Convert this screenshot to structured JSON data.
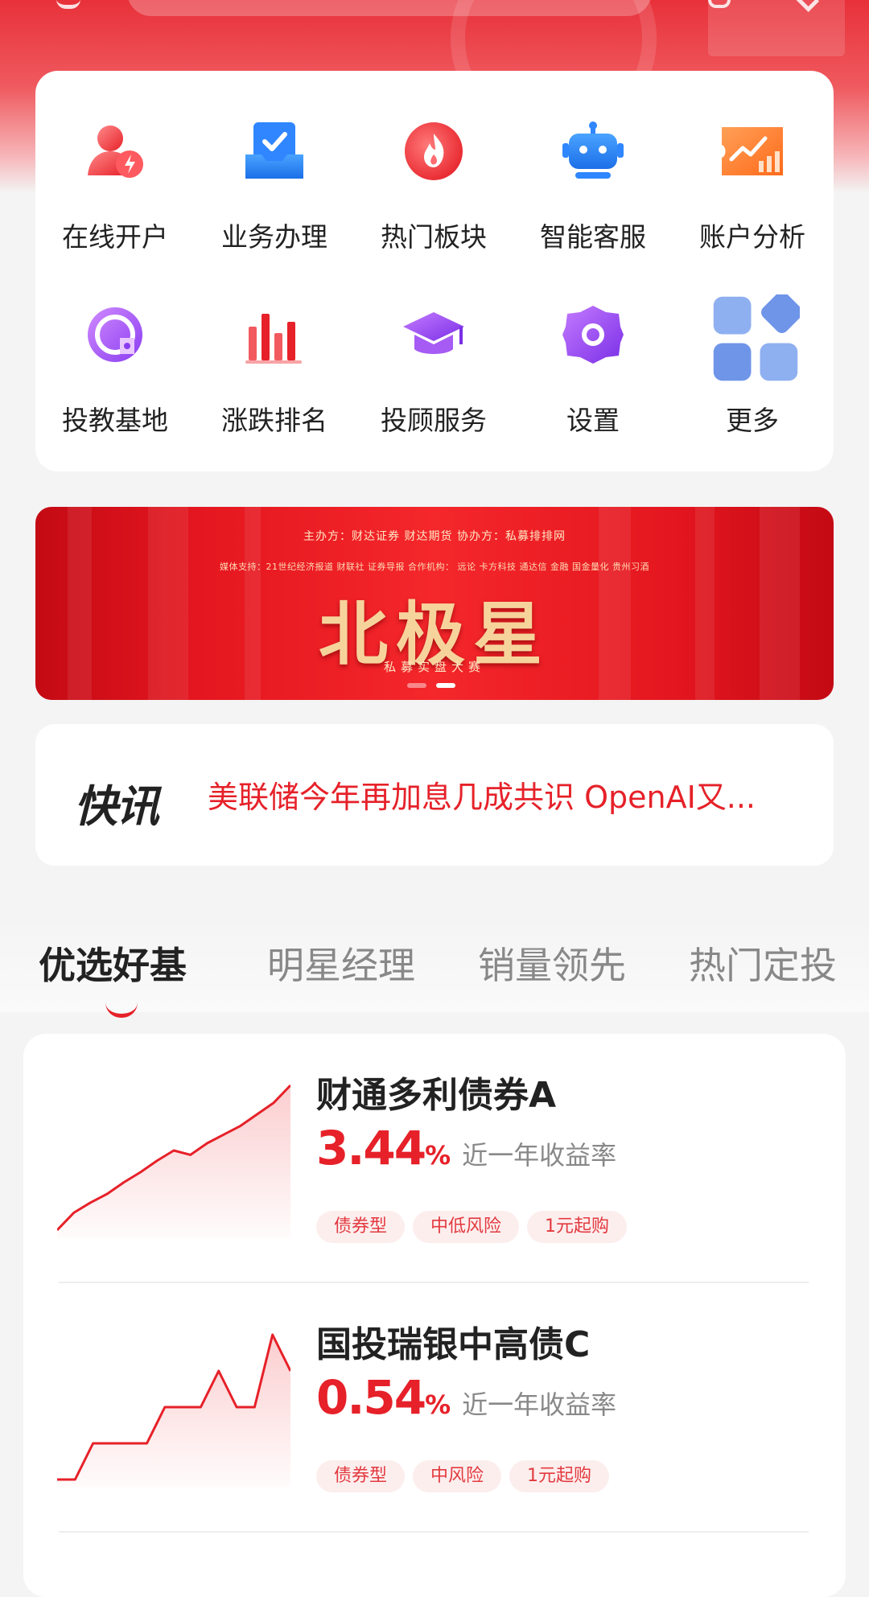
{
  "menu": {
    "items": [
      {
        "label": "在线开户",
        "icon": "user-flash-icon"
      },
      {
        "label": "业务办理",
        "icon": "checklist-tray-icon"
      },
      {
        "label": "热门板块",
        "icon": "flame-icon"
      },
      {
        "label": "智能客服",
        "icon": "robot-icon"
      },
      {
        "label": "账户分析",
        "icon": "trend-chart-icon"
      },
      {
        "label": "投教基地",
        "icon": "education-badge-icon"
      },
      {
        "label": "涨跌排名",
        "icon": "bar-ranking-icon"
      },
      {
        "label": "投顾服务",
        "icon": "graduation-cap-icon"
      },
      {
        "label": "设置",
        "icon": "settings-gear-icon"
      },
      {
        "label": "更多",
        "icon": "more-grid-icon"
      }
    ]
  },
  "banner": {
    "sponsor": "主办方：财达证券 财达期货   协办方：私募排排网",
    "media": "媒体支持：21世纪经济报道  财联社  证券导报   合作机构：  远论  卡方科技  通达信  金融  国金量化  贵州习酒",
    "title": "北极星",
    "subtitle": "私募实盘大赛",
    "slide_count": 2,
    "active_slide": 2
  },
  "news": {
    "logo_text": "快讯",
    "headline": "美联储今年再加息几成共识 OpenAI又..."
  },
  "tabs": [
    {
      "label": "优选好基",
      "active": true
    },
    {
      "label": "明星经理",
      "active": false
    },
    {
      "label": "销量领先",
      "active": false
    },
    {
      "label": "热门定投",
      "active": false
    }
  ],
  "funds": [
    {
      "name": "财通多利债券A",
      "rate": "3.44",
      "rate_unit": "%",
      "rate_label": "近一年收益率",
      "tags": [
        "债券型",
        "中低风险",
        "1元起购"
      ],
      "trend": [
        0.0,
        0.12,
        0.19,
        0.25,
        0.33,
        0.4,
        0.48,
        0.55,
        0.52,
        0.6,
        0.66,
        0.72,
        0.8,
        0.88,
        1.0
      ]
    },
    {
      "name": "国投瑞银中高债C",
      "rate": "0.54",
      "rate_unit": "%",
      "rate_label": "近一年收益率",
      "tags": [
        "债券型",
        "中风险",
        "1元起购"
      ],
      "trend": [
        0.0,
        0.0,
        0.25,
        0.25,
        0.25,
        0.25,
        0.5,
        0.5,
        0.5,
        0.75,
        0.5,
        0.5,
        1.0,
        0.75
      ]
    }
  ],
  "colors": {
    "brand_red": "#e62129",
    "tag_bg": "#fdeeee"
  }
}
